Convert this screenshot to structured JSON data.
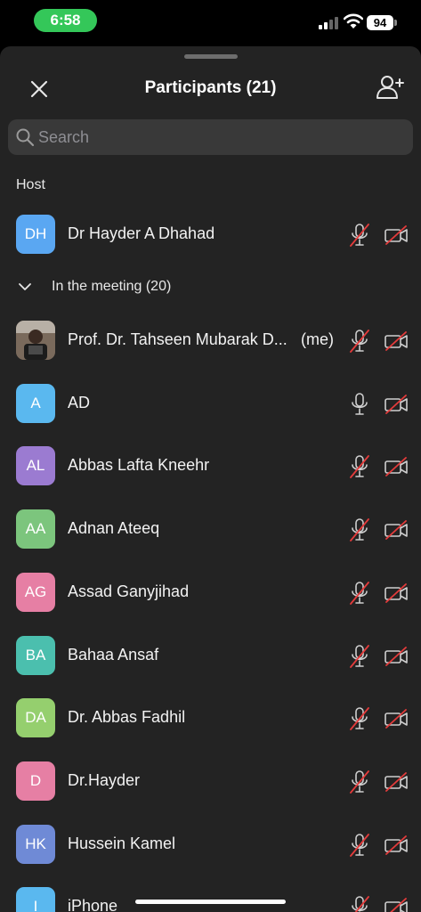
{
  "status_bar": {
    "time": "6:58",
    "battery": "94"
  },
  "header": {
    "title": "Participants (21)"
  },
  "search": {
    "placeholder": "Search"
  },
  "host_section": {
    "label": "Host",
    "participant": {
      "initials": "DH",
      "name": "Dr Hayder A Dhahad",
      "color": "#5aa7f2",
      "mic": "muted",
      "video": "off"
    }
  },
  "meeting_section": {
    "label": "In the meeting (20)",
    "participants": [
      {
        "initials": "",
        "name": "Prof. Dr. Tahseen Mubarak D...",
        "me_label": "(me)",
        "photo": true,
        "mic": "muted",
        "video": "off"
      },
      {
        "initials": "A",
        "name": "AD",
        "color": "#5ab8ef",
        "mic": "on",
        "video": "off"
      },
      {
        "initials": "AL",
        "name": "Abbas Lafta Kneehr",
        "color": "#9b7bd1",
        "mic": "muted",
        "video": "off"
      },
      {
        "initials": "AA",
        "name": "Adnan Ateeq",
        "color": "#7cc57d",
        "mic": "muted",
        "video": "off"
      },
      {
        "initials": "AG",
        "name": "Assad Ganyjihad",
        "color": "#e67fa4",
        "mic": "muted",
        "video": "off"
      },
      {
        "initials": "BA",
        "name": "Bahaa Ansaf",
        "color": "#4bbfae",
        "mic": "muted",
        "video": "off"
      },
      {
        "initials": "DA",
        "name": "Dr. Abbas Fadhil",
        "color": "#95cf6e",
        "mic": "muted",
        "video": "off"
      },
      {
        "initials": "D",
        "name": "Dr.Hayder",
        "color": "#e67fa4",
        "mic": "muted",
        "video": "off"
      },
      {
        "initials": "HK",
        "name": "Hussein Kamel",
        "color": "#6f8ad6",
        "mic": "muted",
        "video": "off"
      },
      {
        "initials": "I",
        "name": "iPhone",
        "color": "#5ab8ef",
        "mic": "muted",
        "video": "off"
      }
    ]
  }
}
